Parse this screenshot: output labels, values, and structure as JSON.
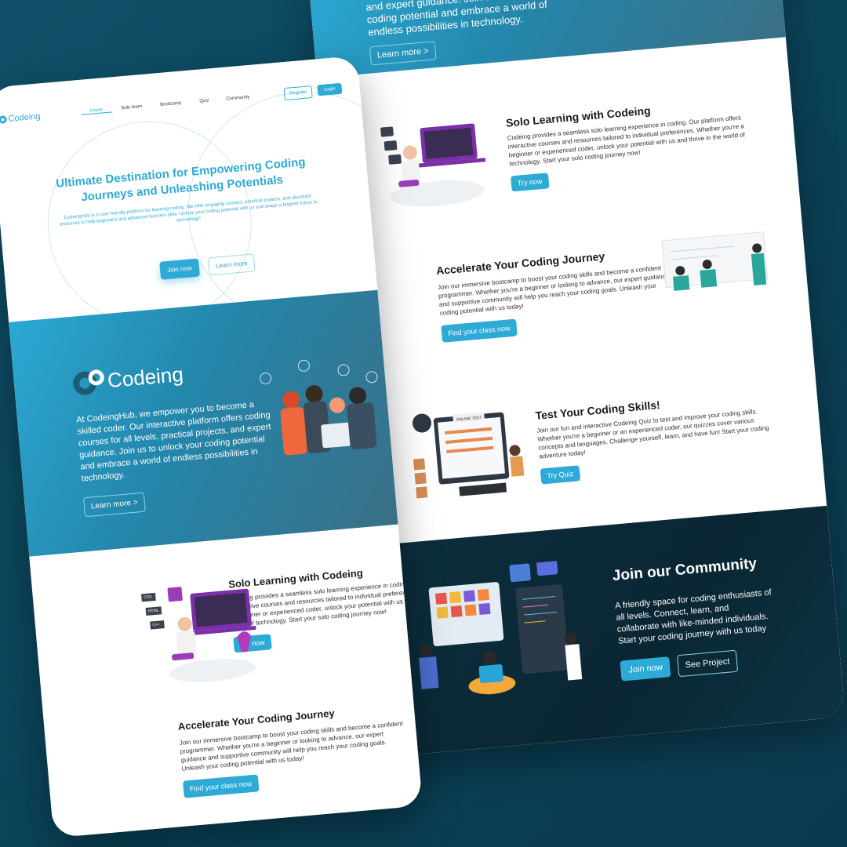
{
  "brand": {
    "name": "Codeing",
    "logo_big": "Codeing"
  },
  "nav": {
    "items": [
      "Home",
      "Solo learn",
      "Bootcamp",
      "Quiz",
      "Community"
    ],
    "register": "Register",
    "login": "Login"
  },
  "hero": {
    "title": "Ultimate Destination for Empowering Coding Journeys and Unleashing Potentials",
    "subtitle": "CodeingHub is a user-friendly platform for learning coding. We offer engaging courses, practical projects, and abundant resources to help beginners and advanced learners alike. Unlock your coding potential with us and shape a brighter future in technology!",
    "join": "Join now",
    "learn": "Learn more"
  },
  "about": {
    "text": "At CodeingHub, we empower you to become a skilled coder. Our interactive platform offers coding courses for all levels, practical projects, and expert guidance. Join us to unlock your coding potential and embrace a world of endless possibilities in technology.",
    "back_text": "coding courses for all levels, practical projects, and expert guidance. Join us to unlock your coding potential and embrace a world of endless possibilities in technology.",
    "cta": "Learn more >"
  },
  "solo": {
    "title": "Solo Learning with Codeing",
    "text": "Codeing provides a seamless solo learning experience in coding. Our platform offers interactive courses and resources tailored to individual preferences. Whether you're a beginner or experienced coder, unlock your potential with us and thrive in the world of technology. Start your solo coding journey now!",
    "cta": "Try now"
  },
  "bootcamp": {
    "title": "Accelerate Your Coding Journey",
    "text": "Join our immersive bootcamp to boost your coding skills and become a confident programmer. Whether you're a beginner or looking to advance, our expert guidance and supportive community will help you reach your coding goals. Unleash your coding potential with us today!",
    "cta": "Find your class now"
  },
  "quiz": {
    "title": "Test Your Coding Skills!",
    "text": "Join our fun and interactive Codeing Quiz to test and improve your coding skills. Whether you're a beginner or an experienced coder, our quizzes cover various concepts and languages. Challenge yourself, learn, and have fun! Start your coding adventure today!",
    "cta": "Try Quiz",
    "screen_label": "ONLINE TEST"
  },
  "community": {
    "title": "Join our Community",
    "text": "A friendly space for coding enthusiasts of all levels. Connect, learn, and collaborate with like-minded individuals. Start your coding journey with us today",
    "join": "Join now",
    "project": "See Project"
  },
  "badges": [
    "CSS",
    "HTML",
    "C++"
  ],
  "colors": {
    "accent": "#2eaad6",
    "teal_dark": "#0a4257",
    "community_bg": "#0d2f3f"
  }
}
